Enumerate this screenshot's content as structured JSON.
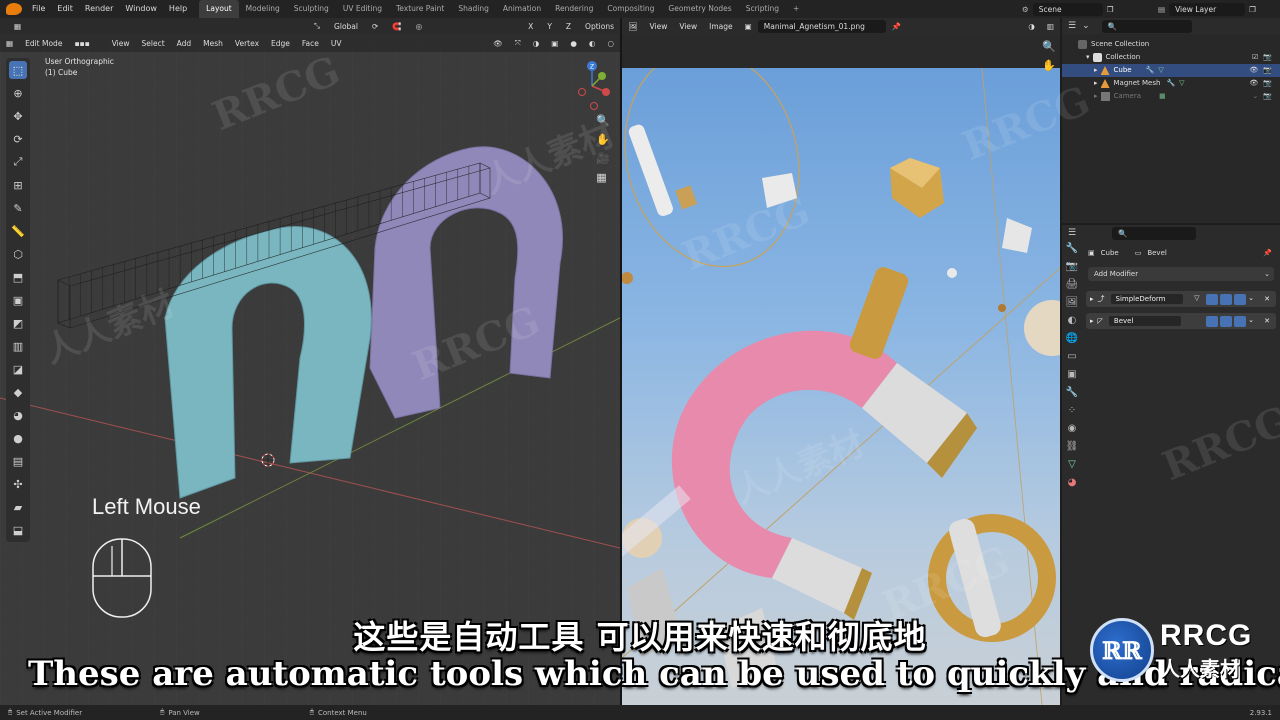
{
  "app": {
    "menus": [
      "File",
      "Edit",
      "Render",
      "Window",
      "Help"
    ],
    "workspaces": [
      "Layout",
      "Modeling",
      "Sculpting",
      "UV Editing",
      "Texture Paint",
      "Shading",
      "Animation",
      "Rendering",
      "Compositing",
      "Geometry Nodes",
      "Scripting"
    ],
    "active_workspace": "Layout",
    "add_workspace": "+",
    "scene": "Scene",
    "view_layer": "View Layer"
  },
  "viewport": {
    "transform_orientation": "Global",
    "options_label": "Options",
    "axes": [
      "X",
      "Y",
      "Z"
    ],
    "mode": "Edit Mode",
    "menus": [
      "View",
      "Select",
      "Add",
      "Mesh",
      "Vertex",
      "Edge",
      "Face",
      "UV"
    ],
    "view_name": "User Orthographic",
    "object_name": "(1) Cube",
    "hint": "Left Mouse"
  },
  "image_editor": {
    "menus": [
      "View",
      "View",
      "Image"
    ],
    "image_name": "Manimal_Agnetism_01.png"
  },
  "outliner": {
    "rows": [
      {
        "label": "Scene Collection"
      },
      {
        "label": "Collection"
      },
      {
        "label": "Cube"
      },
      {
        "label": "Magnet Mesh"
      },
      {
        "label": "Camera"
      }
    ]
  },
  "properties": {
    "object": "Cube",
    "modifier_context": "Bevel",
    "add_modifier": "Add Modifier",
    "modifiers": [
      {
        "name": "SimpleDeform"
      },
      {
        "name": "Bevel"
      }
    ]
  },
  "statusbar": {
    "left": "Set Active Modifier",
    "middle": "Pan View",
    "right": "Context Menu",
    "version": "2.93.1"
  },
  "subtitles": {
    "chinese": "这些是自动工具 可以用来快速和彻底地",
    "english": "These are automatic tools which can be used to quickly and radically"
  },
  "watermark": {
    "text": "RRCG",
    "cn": "人人素材",
    "logo_big": "RRCG",
    "logo_small": "人人素材"
  }
}
